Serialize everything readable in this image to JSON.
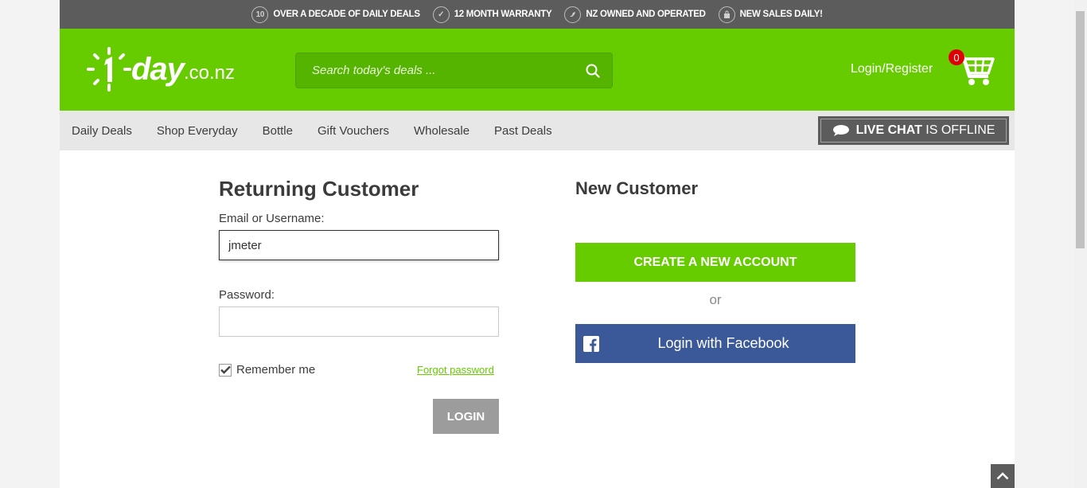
{
  "promo_bar": {
    "items": [
      {
        "icon": "ten-years-icon",
        "icon_text": "10",
        "label": "OVER A DECADE OF DAILY DEALS"
      },
      {
        "icon": "checkmark-icon",
        "icon_text": "✓",
        "label": "12 MONTH WARRANTY"
      },
      {
        "icon": "nz-map-icon",
        "icon_text": "",
        "label": "NZ OWNED AND OPERATED"
      },
      {
        "icon": "shopping-bag-icon",
        "icon_text": "",
        "label": "NEW SALES DAILY!"
      }
    ]
  },
  "header": {
    "logo": {
      "main": "day",
      "tld": ".co.nz"
    },
    "search": {
      "placeholder": "Search today's deals ..."
    },
    "login_register": "Login/Register",
    "cart_count": "0"
  },
  "nav": {
    "items": [
      "Daily Deals",
      "Shop Everyday",
      "Bottle",
      "Gift Vouchers",
      "Wholesale",
      "Past Deals"
    ],
    "live_chat": {
      "bold": "LIVE CHAT",
      "rest": "IS OFFLINE"
    }
  },
  "returning": {
    "title": "Returning Customer",
    "email_label": "Email or Username:",
    "email_value": "jmeter",
    "password_label": "Password:",
    "password_value": "",
    "remember_label": "Remember me",
    "remember_checked": true,
    "forgot_label": "Forgot password",
    "login_button": "LOGIN"
  },
  "new_customer": {
    "title": "New Customer",
    "create_button": "CREATE A NEW ACCOUNT",
    "or_text": "or",
    "facebook_button": "Login with Facebook"
  },
  "colors": {
    "brand_green": "#66cc00",
    "dark_gray": "#5c5c5c",
    "facebook_blue": "#3b5998",
    "badge_red": "#e10000"
  }
}
